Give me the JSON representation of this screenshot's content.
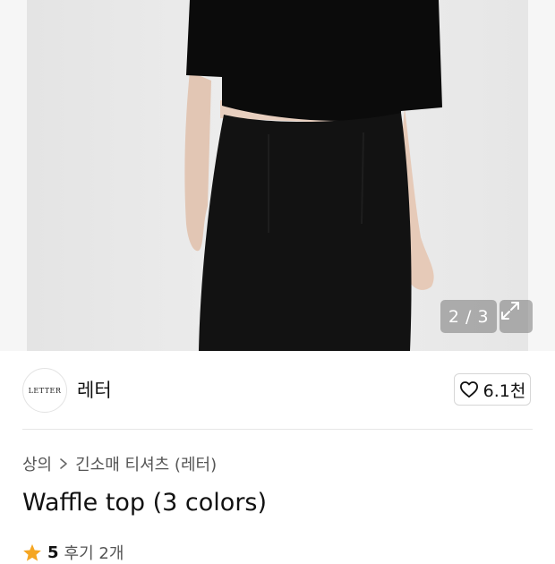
{
  "gallery": {
    "pager_text": "2 / 3"
  },
  "brand": {
    "logo_text": "LETTER",
    "name": "레터",
    "likes": "6.1천"
  },
  "breadcrumb": {
    "items": [
      "상의",
      "긴소매 티셔츠 (레터)"
    ]
  },
  "product": {
    "title": "Waffle top (3 colors)"
  },
  "rating": {
    "score": "5",
    "reviews_label": "후기 2개",
    "star_color": "#f5a623"
  },
  "icons": {
    "expand": "expand-icon",
    "heart": "heart-icon",
    "chevron": "chevron-right-icon",
    "star": "star-icon"
  }
}
